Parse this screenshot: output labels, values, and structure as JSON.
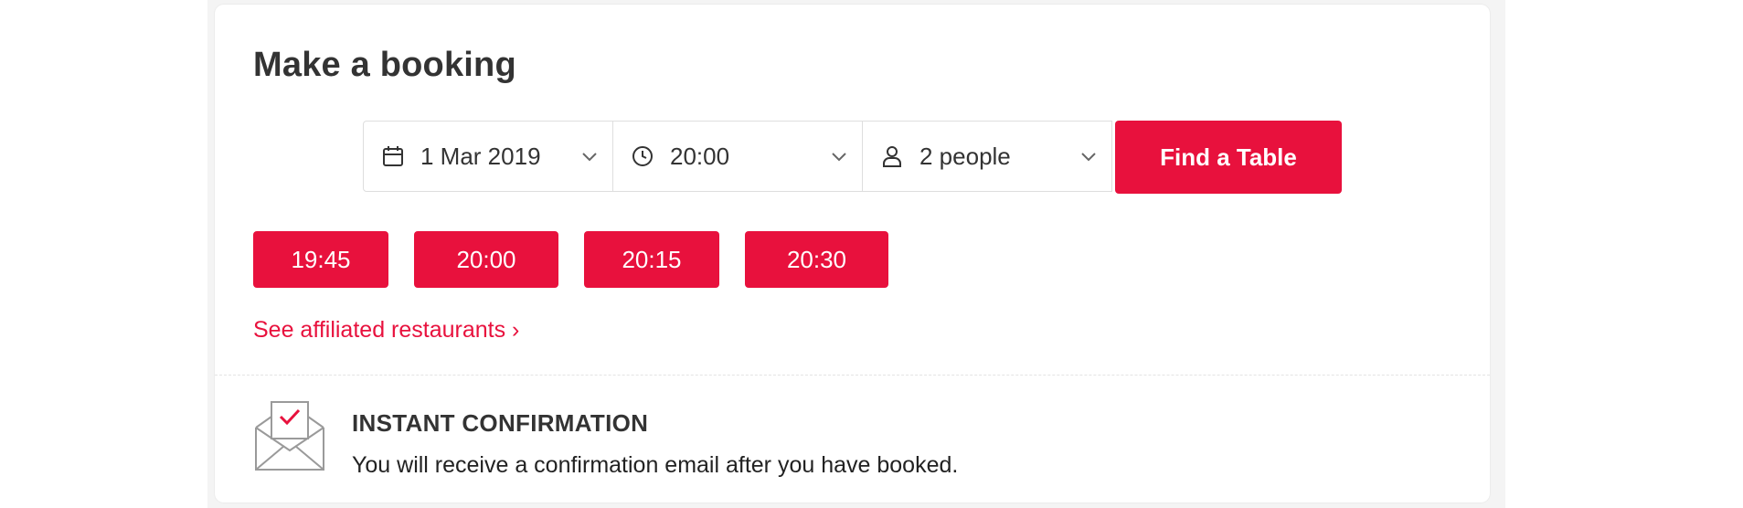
{
  "booking": {
    "title": "Make a booking",
    "date": {
      "value": "1 Mar 2019",
      "icon": "calendar-icon"
    },
    "time": {
      "value": "20:00",
      "icon": "clock-icon"
    },
    "party": {
      "value": "2 people",
      "icon": "person-icon"
    },
    "find_button_label": "Find a Table",
    "slots": [
      "19:45",
      "20:00",
      "20:15",
      "20:30"
    ],
    "affiliated_link": "See affiliated restaurants ›"
  },
  "confirmation": {
    "icon": "envelope-check-icon",
    "title": "INSTANT CONFIRMATION",
    "text": "You will receive a confirmation email after you have booked."
  },
  "colors": {
    "accent": "#e8113d",
    "text": "#333333",
    "border": "#dedede"
  }
}
